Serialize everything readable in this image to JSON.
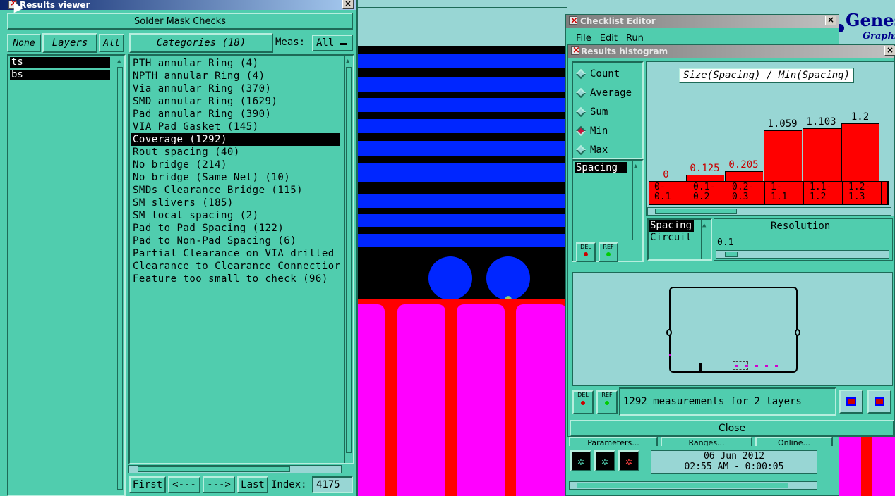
{
  "results_viewer": {
    "title": "Results viewer",
    "header": "Solder Mask Checks",
    "none_btn": "None",
    "layers_btn": "Layers",
    "all_btn": "All",
    "categories_btn": "Categories (18)",
    "meas_label": "Meas:",
    "meas_value": "All",
    "layers": [
      "ts",
      "bs"
    ],
    "categories": [
      "PTH annular Ring (4)",
      "NPTH annular Ring (4)",
      "Via annular Ring (370)",
      "SMD annular Ring (1629)",
      "Pad annular Ring (390)",
      "VIA Pad Gasket (145)",
      "Coverage (1292)",
      "Rout spacing (40)",
      "No bridge (214)",
      "No bridge (Same Net) (10)",
      "SMDs Clearance Bridge (115)",
      "SM slivers (185)",
      "SM local spacing (2)",
      "Pad to Pad Spacing (122)",
      "Pad to Non-Pad Spacing (6)",
      "Partial Clearance on VIA drilled",
      "Clearance to Clearance Connectior",
      "Feature too small to check (96)"
    ],
    "selected_category_index": 6,
    "first_btn": "First",
    "prev_btn": "<---",
    "next_btn": "--->",
    "last_btn": "Last",
    "index_label": "Index:",
    "index_value": "4175"
  },
  "checklist_editor": {
    "title": "Checklist Editor",
    "menu": [
      "File",
      "Edit",
      "Run"
    ],
    "tabs": [
      "Parameters...",
      "Ranges...",
      "Online..."
    ],
    "date": "06 Jun 2012",
    "time": "02:55 AM - 0:00:05"
  },
  "genesis_logo": {
    "text": "Genesi",
    "sub": "Graphi"
  },
  "histogram": {
    "title": "Results histogram",
    "modes": [
      "Count",
      "Average",
      "Sum",
      "Min",
      "Max"
    ],
    "selected_mode": "Min",
    "chart_title": "Size(Spacing) / Min(Spacing)",
    "list_items": [
      "Spacing"
    ],
    "del_label": "DEL",
    "ref_label": "REF",
    "resolution_label": "Resolution",
    "resolution_value": "0.1",
    "res_list": [
      "Spacing",
      "Circuit"
    ],
    "status": "1292 measurements for 2 layers",
    "close_btn": "Close",
    "colors": {
      "bar": "#ff0000",
      "zero_label": "#c80000"
    }
  },
  "chart_data": {
    "type": "bar",
    "title": "Size(Spacing) / Min(Spacing)",
    "categories": [
      "0-\n0.1",
      "0.1-\n0.2",
      "0.2-\n0.3",
      "1-\n1.1",
      "1.1-\n1.2",
      "1.2-\n1.3"
    ],
    "values": [
      0,
      0.125,
      0.205,
      1.059,
      1.103,
      1.2
    ],
    "value_labels": [
      "0",
      "0.125",
      "0.205",
      "1.059",
      "1.103",
      "1.2"
    ]
  }
}
